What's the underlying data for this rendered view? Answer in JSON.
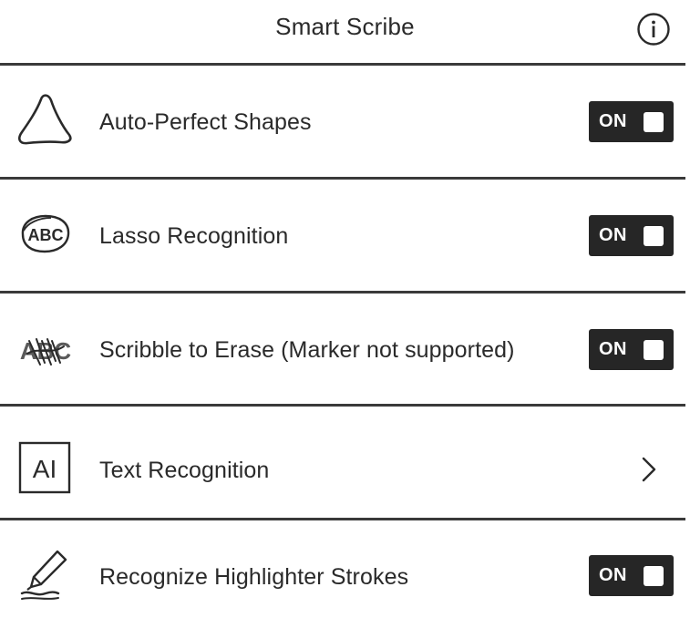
{
  "header": {
    "title": "Smart Scribe",
    "info_icon": "info-circle-icon"
  },
  "rows": [
    {
      "label": "Auto-Perfect Shapes",
      "icon": "triangle-shape-icon",
      "control": "toggle",
      "state": "ON"
    },
    {
      "label": "Lasso Recognition",
      "icon": "abc-lasso-icon",
      "control": "toggle",
      "state": "ON"
    },
    {
      "label": "Scribble to Erase (Marker not supported)",
      "icon": "abc-scribble-icon",
      "control": "toggle",
      "state": "ON"
    },
    {
      "label": "Text Recognition",
      "icon": "ai-text-box-icon",
      "control": "chevron"
    },
    {
      "label": "Recognize Highlighter Strokes",
      "icon": "highlighter-pen-icon",
      "control": "toggle",
      "state": "ON"
    }
  ],
  "icon_text": {
    "lasso": "ABC",
    "scribble": "ABC",
    "text_box": "AI"
  },
  "colors": {
    "background": "#ffffff",
    "text": "#2a2a2a",
    "divider": "#3a3a3a",
    "toggle_bg": "#262626",
    "toggle_text": "#ffffff"
  }
}
